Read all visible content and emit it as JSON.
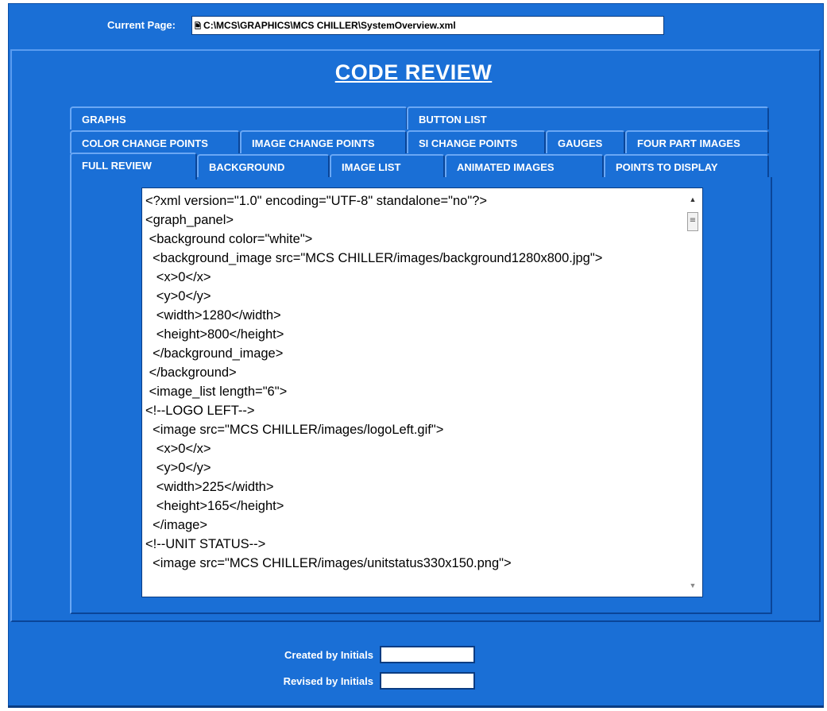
{
  "header": {
    "current_page_label": "Current Page:",
    "current_page_value": "C:\\MCS\\GRAPHICS\\MCS CHILLER\\SystemOverview.xml",
    "file_icon": "document-icon"
  },
  "title": "CODE REVIEW",
  "tabs": {
    "row1": [
      "GRAPHS",
      "BUTTON LIST"
    ],
    "row2": [
      "COLOR CHANGE POINTS",
      "IMAGE CHANGE POINTS",
      "SI CHANGE POINTS",
      "GAUGES",
      "FOUR PART IMAGES"
    ],
    "row3": [
      "FULL REVIEW",
      "BACKGROUND",
      "IMAGE LIST",
      "ANIMATED IMAGES",
      "POINTS TO DISPLAY"
    ],
    "active": "FULL REVIEW"
  },
  "code_review": {
    "text": "<?xml version=\"1.0\" encoding=\"UTF-8\" standalone=\"no\"?>\n<graph_panel>\n <background color=\"white\">\n  <background_image src=\"MCS CHILLER/images/background1280x800.jpg\">\n   <x>0</x>\n   <y>0</y>\n   <width>1280</width>\n   <height>800</height>\n  </background_image>\n </background>\n <image_list length=\"6\">\n<!--LOGO LEFT-->\n  <image src=\"MCS CHILLER/images/logoLeft.gif\">\n   <x>0</x>\n   <y>0</y>\n   <width>225</width>\n   <height>165</height>\n  </image>\n<!--UNIT STATUS-->\n  <image src=\"MCS CHILLER/images/unitstatus330x150.png\">"
  },
  "footer": {
    "created_label": "Created by Initials",
    "created_value": "",
    "revised_label": "Revised by Initials",
    "revised_value": ""
  },
  "colors": {
    "background_blue": "#1a6fd6",
    "border_dark": "#0a4598",
    "text_white": "#ffffff"
  }
}
